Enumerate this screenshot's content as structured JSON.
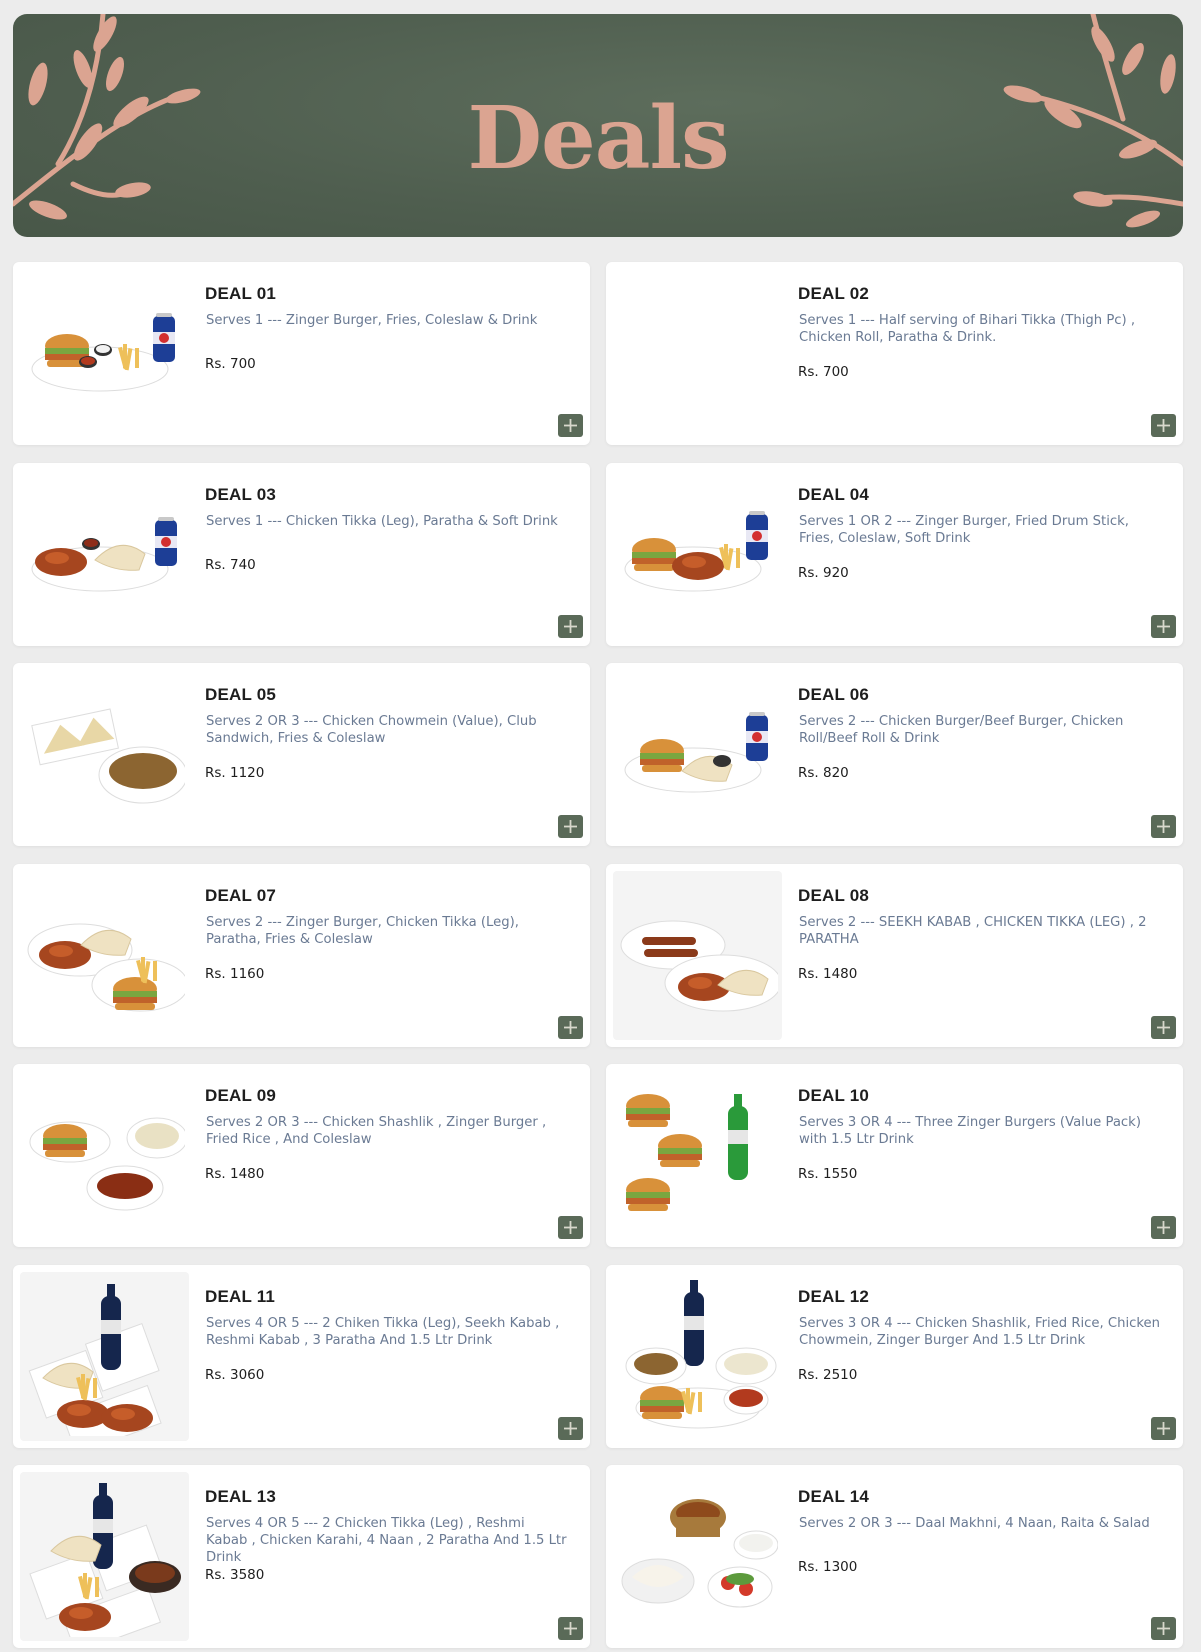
{
  "banner": {
    "title": "Deals"
  },
  "colors": {
    "accent": "#5a6a58",
    "banner_bg": "#4f5e4f",
    "leaf": "#dba491",
    "desc_text": "#6a7a93"
  },
  "deals": [
    {
      "title": "DEAL 01",
      "description": "Serves 1 --- Zinger Burger, Fries, Coleslaw & Drink",
      "price": "Rs. 700",
      "image": "burger-fries-pepsi",
      "has_image": true
    },
    {
      "title": "DEAL 02",
      "description": "Serves 1 --- Half serving of Bihari Tikka (Thigh Pc) , Chicken Roll, Paratha & Drink.",
      "price": "Rs. 700",
      "image": "none",
      "has_image": false
    },
    {
      "title": "DEAL 03",
      "description": "Serves 1 --- Chicken Tikka (Leg), Paratha & Soft Drink",
      "price": "Rs. 740",
      "image": "tikka-paratha-pepsi",
      "has_image": true
    },
    {
      "title": "DEAL 04",
      "description": "Serves 1 OR 2 --- Zinger Burger, Fried Drum Stick, Fries, Coleslaw, Soft Drink",
      "price": "Rs. 920",
      "image": "burger-drumstick-pepsi",
      "has_image": true
    },
    {
      "title": "DEAL 05",
      "description": "Serves 2 OR 3 --- Chicken Chowmein (Value), Club Sandwich, Fries & Coleslaw",
      "price": "Rs. 1120",
      "image": "sandwich-chowmein",
      "has_image": true
    },
    {
      "title": "DEAL 06",
      "description": "Serves 2 --- Chicken Burger/Beef Burger, Chicken Roll/Beef Roll & Drink",
      "price": "Rs. 820",
      "image": "burger-roll-pepsi",
      "has_image": true
    },
    {
      "title": "DEAL 07",
      "description": "Serves 2 --- Zinger Burger, Chicken Tikka (Leg), Paratha, Fries & Coleslaw",
      "price": "Rs. 1160",
      "image": "tikka-burger-fries",
      "has_image": true
    },
    {
      "title": "DEAL 08",
      "description": "Serves 2 --- SEEKH KABAB , CHICKEN TIKKA (LEG) , 2 PARATHA",
      "price": "Rs. 1480",
      "image": "kabab-tikka-paratha",
      "has_image": true
    },
    {
      "title": "DEAL 09",
      "description": "Serves 2 OR 3 --- Chicken Shashlik , Zinger Burger , Fried Rice , And Coleslaw",
      "price": "Rs. 1480",
      "image": "burger-rice-shashlik",
      "has_image": true
    },
    {
      "title": "DEAL 10",
      "description": "Serves 3 OR 4 --- Three Zinger Burgers (Value Pack) with 1.5 Ltr Drink",
      "price": "Rs. 1550",
      "image": "three-burgers-green-bottle",
      "has_image": true
    },
    {
      "title": "DEAL 11",
      "description": "Serves 4 OR 5 --- 2 Chiken Tikka (Leg), Seekh Kabab , Reshmi Kabab , 3 Paratha And 1.5 Ltr Drink",
      "price": "Rs. 3060",
      "image": "platter-pepsi-bottle",
      "has_image": true
    },
    {
      "title": "DEAL 12",
      "description": "Serves 3 OR 4 --- Chicken Shashlik, Fried Rice, Chicken Chowmein, Zinger Burger And 1.5 Ltr Drink",
      "price": "Rs. 2510",
      "image": "chowmein-rice-pepsi-bottle",
      "has_image": true
    },
    {
      "title": "DEAL 13",
      "description": "Serves 4 OR 5 --- 2 Chicken Tikka (Leg) , Reshmi Kabab , Chicken Karahi, 4 Naan , 2 Paratha And 1.5 Ltr Drink",
      "price": "Rs. 3580",
      "image": "karahi-platter-pepsi-bottle",
      "has_image": true
    },
    {
      "title": "DEAL 14",
      "description": "Serves 2 OR 3 --- Daal Makhni, 4 Naan, Raita & Salad",
      "price": "Rs. 1300",
      "image": "daal-naan-salad",
      "has_image": true
    }
  ]
}
